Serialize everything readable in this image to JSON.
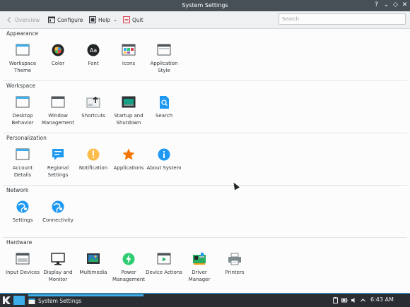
{
  "window": {
    "title": "System Settings",
    "buttons": [
      "?",
      "⌄",
      "◇",
      "✕"
    ]
  },
  "toolbar": {
    "overview": "Overview",
    "configure": "Configure",
    "help": "Help",
    "quit": "Quit",
    "search_placeholder": "Search"
  },
  "sections": [
    {
      "name": "Appearance",
      "items": [
        {
          "label": "Workspace Theme",
          "icon": "workspace-theme-icon"
        },
        {
          "label": "Color",
          "icon": "color-icon"
        },
        {
          "label": "Font",
          "icon": "font-icon"
        },
        {
          "label": "Icons",
          "icon": "icons-icon"
        },
        {
          "label": "Application Style",
          "icon": "application-style-icon"
        }
      ]
    },
    {
      "name": "Workspace",
      "items": [
        {
          "label": "Desktop Behavior",
          "icon": "desktop-behavior-icon"
        },
        {
          "label": "Window Management",
          "icon": "window-management-icon"
        },
        {
          "label": "Shortcuts",
          "icon": "shortcuts-icon"
        },
        {
          "label": "Startup and Shutdown",
          "icon": "startup-shutdown-icon"
        },
        {
          "label": "Search",
          "icon": "search-icon"
        }
      ]
    },
    {
      "name": "Personalization",
      "items": [
        {
          "label": "Account Details",
          "icon": "account-details-icon"
        },
        {
          "label": "Regional Settings",
          "icon": "regional-settings-icon"
        },
        {
          "label": "Notification",
          "icon": "notification-icon"
        },
        {
          "label": "Applications",
          "icon": "applications-star-icon"
        },
        {
          "label": "About System",
          "icon": "about-system-icon"
        }
      ]
    },
    {
      "name": "Network",
      "items": [
        {
          "label": "Settings",
          "icon": "network-settings-icon"
        },
        {
          "label": "Connectivity",
          "icon": "connectivity-icon"
        }
      ]
    },
    {
      "name": "Hardware",
      "items": [
        {
          "label": "Input Devices",
          "icon": "input-devices-icon"
        },
        {
          "label": "Display and Monitor",
          "icon": "display-monitor-icon"
        },
        {
          "label": "Multimedia",
          "icon": "multimedia-icon"
        },
        {
          "label": "Power Management",
          "icon": "power-management-icon"
        },
        {
          "label": "Device Actions",
          "icon": "device-actions-icon"
        },
        {
          "label": "Driver Manager",
          "icon": "driver-manager-icon"
        },
        {
          "label": "Printers",
          "icon": "printers-icon"
        }
      ]
    }
  ],
  "taskbar": {
    "task": "System Settings",
    "clock": "6:43 AM"
  },
  "colors": {
    "accent": "#3daee9",
    "titlebar": "#475057",
    "panel": "#2a2e32"
  }
}
